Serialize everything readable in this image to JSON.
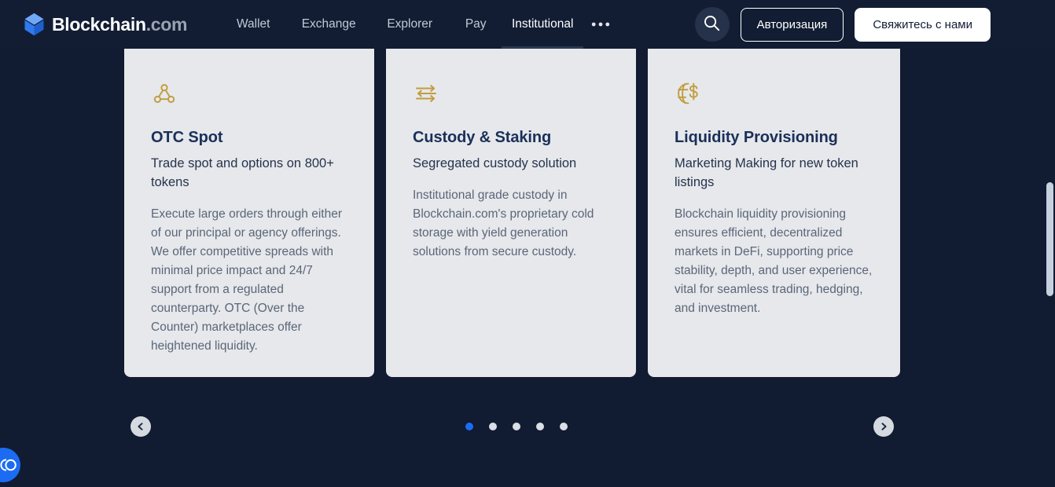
{
  "header": {
    "brand": {
      "name": "Blockchain",
      "suffix": ".com",
      "logo_icon": "blockchain-cube-logo"
    },
    "nav": [
      {
        "label": "Wallet",
        "active": false
      },
      {
        "label": "Exchange",
        "active": false
      },
      {
        "label": "Explorer",
        "active": false
      },
      {
        "label": "Pay",
        "active": false
      },
      {
        "label": "Institutional",
        "active": true
      }
    ],
    "more_icon": "ellipsis-horizontal-icon",
    "search_icon": "search-icon",
    "login_label": "Авторизация",
    "contact_label": "Свяжитесь с нами"
  },
  "carousel": {
    "cards": [
      {
        "icon": "network-nodes-icon",
        "title": "OTC Spot",
        "subtitle": "Trade spot and options on 800+ tokens",
        "body": "Execute large orders through either of our principal or agency offerings. We offer competitive spreads with minimal price impact and 24/7 support from a regulated counterparty. OTC (Over the Counter) marketplaces offer heightened liquidity."
      },
      {
        "icon": "swap-arrows-icon",
        "title": "Custody & Staking",
        "subtitle": "Segregated custody solution",
        "body": "Institutional grade custody in Blockchain.com's proprietary cold storage with yield generation solutions from secure custody."
      },
      {
        "icon": "globe-dollar-icon",
        "title": "Liquidity Provisioning",
        "subtitle": "Marketing Making for new token listings",
        "body": "Blockchain liquidity provisioning ensures efficient, decentralized markets in DeFi, supporting price stability, depth, and user experience, vital for seamless trading, hedging, and investment."
      }
    ],
    "prev_icon": "chevron-left-circle-icon",
    "next_icon": "chevron-right-circle-icon",
    "dot_count": 5,
    "active_dot_index": 0
  },
  "accessibility_widget": {
    "icon": "accessibility-toggle-icon"
  },
  "colors": {
    "page_background": "#111b31",
    "header_background": "#121d33",
    "card_background": "#e6e8eb",
    "card_title": "#1a3059",
    "card_body_text": "#5b6679",
    "icon_gold": "#c29c3e",
    "accent_blue": "#1b6cf2",
    "logo_blue": "#3d89f5"
  }
}
